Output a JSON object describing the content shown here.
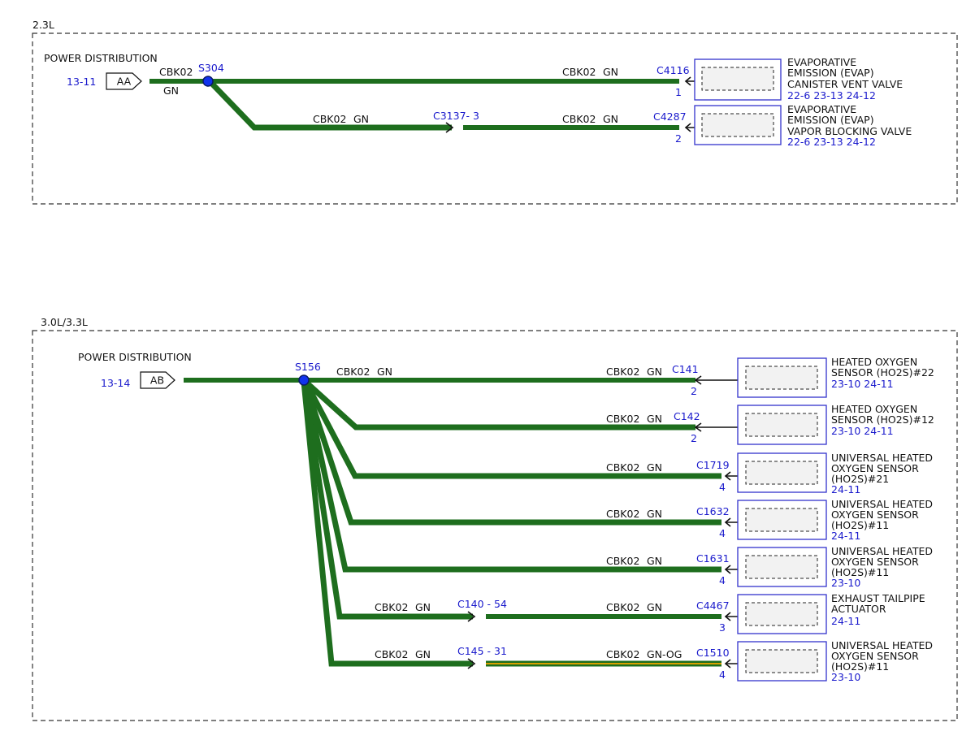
{
  "sections": [
    {
      "title": "2.3L",
      "power_label": "POWER DISTRIBUTION",
      "page_ref": "13-11",
      "connector": "AA",
      "feed_wire": {
        "circuit": "CBK02",
        "color": "GN"
      },
      "splice": "S304",
      "branches": [
        {
          "segments": [
            {
              "circuit": "CBK02",
              "color": "GN"
            }
          ],
          "connector": "C4116",
          "pin": "1",
          "component": [
            "EVAPORATIVE",
            "EMISSION (EVAP)",
            "CANISTER VENT VALVE"
          ],
          "refs": "22-6  23-13  24-12"
        },
        {
          "segments": [
            {
              "circuit": "CBK02",
              "color": "GN"
            },
            {
              "circuit": "CBK02",
              "color": "GN"
            }
          ],
          "inline_connector": "C3137- 3",
          "connector": "C4287",
          "pin": "2",
          "component": [
            "EVAPORATIVE",
            "EMISSION (EVAP)",
            "VAPOR BLOCKING VALVE"
          ],
          "refs": "22-6  23-13  24-12"
        }
      ]
    },
    {
      "title": "3.0L/3.3L",
      "power_label": "POWER DISTRIBUTION",
      "page_ref": "13-14",
      "connector": "AB",
      "splice": "S156",
      "branches": [
        {
          "segments": [
            {
              "circuit": "CBK02",
              "color": "GN"
            },
            {
              "circuit": "CBK02",
              "color": "GN"
            }
          ],
          "connector": "C141",
          "pin": "2",
          "component": [
            "HEATED OXYGEN",
            "SENSOR (HO2S)#22"
          ],
          "refs": "23-10 24-11"
        },
        {
          "segments": [
            {
              "circuit": "CBK02",
              "color": "GN"
            }
          ],
          "connector": "C142",
          "pin": "2",
          "component": [
            "HEATED OXYGEN",
            "SENSOR (HO2S)#12"
          ],
          "refs": "23-10 24-11"
        },
        {
          "segments": [
            {
              "circuit": "CBK02",
              "color": "GN"
            }
          ],
          "connector": "C1719",
          "pin": "4",
          "component": [
            "UNIVERSAL HEATED",
            "OXYGEN SENSOR",
            "(HO2S)#21"
          ],
          "refs": "24-11"
        },
        {
          "segments": [
            {
              "circuit": "CBK02",
              "color": "GN"
            }
          ],
          "connector": "C1632",
          "pin": "4",
          "component": [
            "UNIVERSAL HEATED",
            "OXYGEN SENSOR",
            "(HO2S)#11"
          ],
          "refs": "24-11"
        },
        {
          "segments": [
            {
              "circuit": "CBK02",
              "color": "GN"
            }
          ],
          "connector": "C1631",
          "pin": "4",
          "component": [
            "UNIVERSAL HEATED",
            "OXYGEN SENSOR",
            "(HO2S)#11"
          ],
          "refs": "23-10"
        },
        {
          "segments": [
            {
              "circuit": "CBK02",
              "color": "GN"
            },
            {
              "circuit": "CBK02",
              "color": "GN"
            }
          ],
          "inline_connector": "C140  - 54",
          "connector": "C4467",
          "pin": "3",
          "component": [
            "EXHAUST TAILPIPE",
            "ACTUATOR"
          ],
          "refs": "24-11"
        },
        {
          "segments": [
            {
              "circuit": "CBK02",
              "color": "GN"
            },
            {
              "circuit": "CBK02",
              "color": "GN-OG"
            }
          ],
          "inline_connector": "C145  - 31",
          "connector": "C1510",
          "pin": "4",
          "component": [
            "UNIVERSAL HEATED",
            "OXYGEN SENSOR",
            "(HO2S)#11"
          ],
          "refs": "23-10"
        }
      ]
    }
  ],
  "colors": {
    "wire_green": "#1e6e1e",
    "stripe_orange": "#d8a000",
    "ref_blue": "#1a1acc",
    "splice_blue": "#1133ee"
  }
}
